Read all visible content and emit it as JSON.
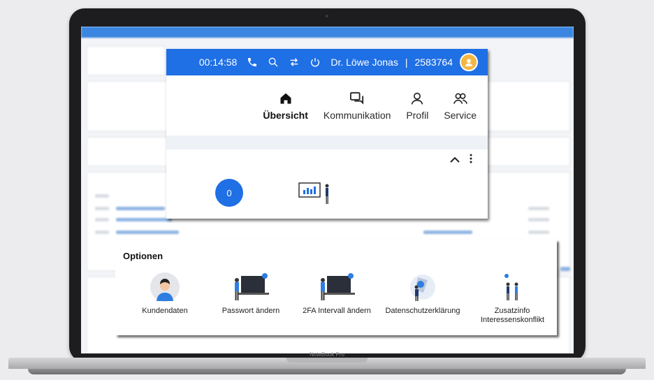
{
  "topbar": {
    "timer": "00:14:58",
    "user_name": "Dr. Löwe Jonas",
    "separator": "|",
    "customer_number": "2583764"
  },
  "nav": {
    "items": [
      {
        "label": "Übersicht",
        "icon": "home-icon",
        "active": true
      },
      {
        "label": "Kommunikation",
        "icon": "chat-icon",
        "active": false
      },
      {
        "label": "Profil",
        "icon": "user-icon",
        "active": false
      },
      {
        "label": "Service",
        "icon": "people-icon",
        "active": false
      }
    ]
  },
  "overview": {
    "badge_count": "0"
  },
  "options": {
    "title": "Optionen",
    "items": [
      {
        "label": "Kundendaten",
        "icon": "person-avatar-icon"
      },
      {
        "label": "Passwort ändern",
        "icon": "laptop-person-icon"
      },
      {
        "label": "2FA Intervall ändern",
        "icon": "laptop-person-icon"
      },
      {
        "label": "Datenschutzerklärung",
        "icon": "privacy-illustration-icon"
      },
      {
        "label": "Zusatzinfo Interessenskonflikt",
        "icon": "people-discussion-icon"
      }
    ]
  },
  "device": {
    "brand": "NoteBook Pro"
  },
  "colors": {
    "primary": "#1f6fe5",
    "badge": "#f5b642"
  }
}
